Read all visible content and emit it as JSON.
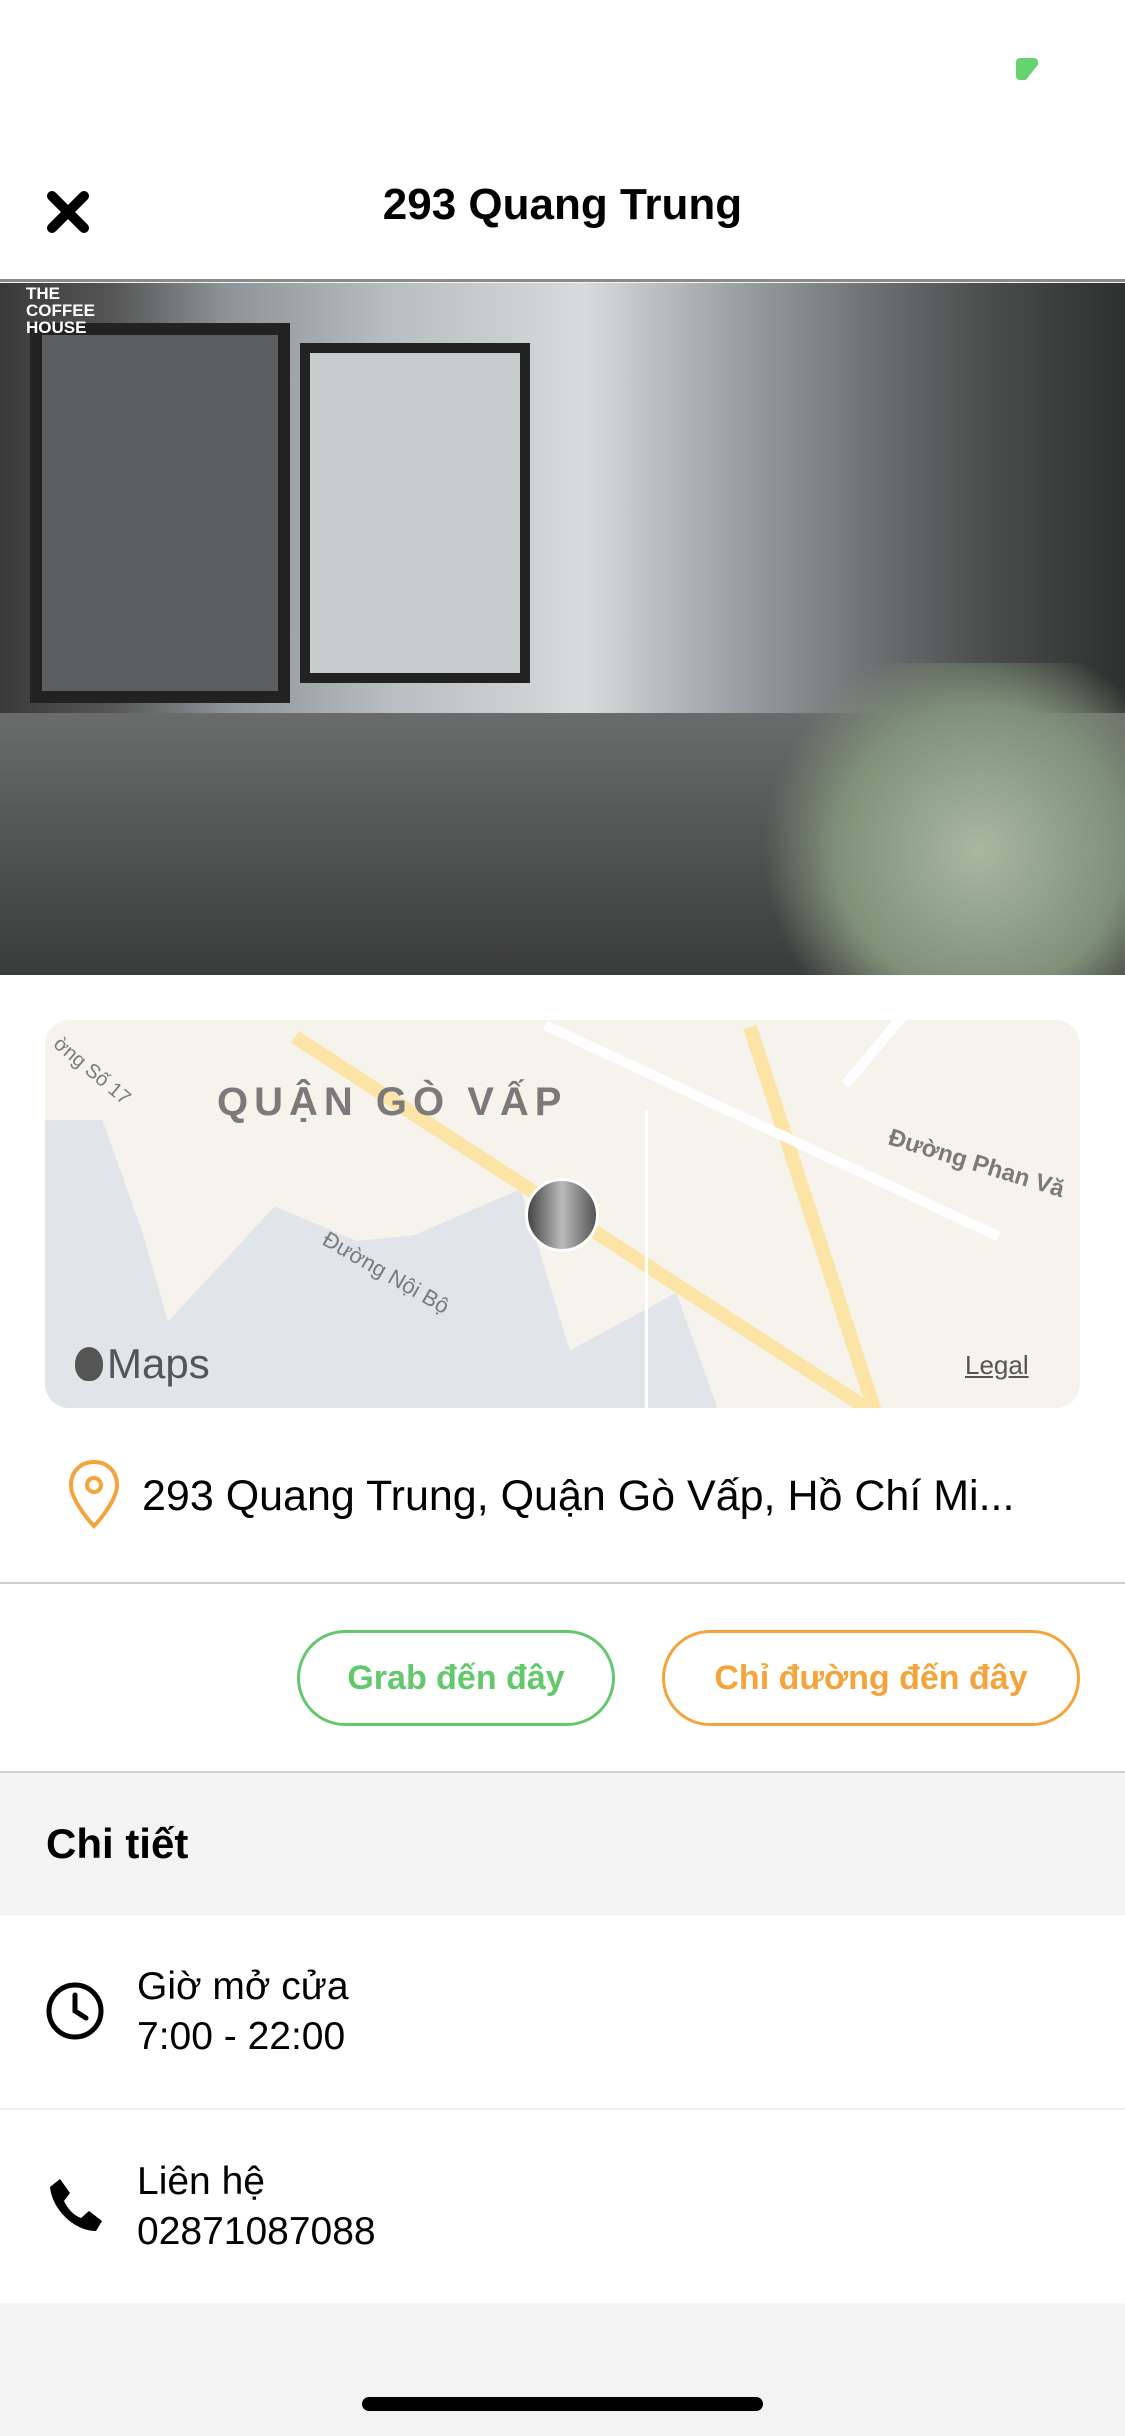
{
  "status_bar": {
    "battery_color": "#65d46e"
  },
  "nav": {
    "title": "293 Quang Trung",
    "close_icon": "close-icon"
  },
  "photo": {
    "logo_lines": [
      "THE",
      "COFFEE",
      "HOUSE"
    ]
  },
  "map": {
    "district_label": "QUẬN GÒ VẤP",
    "street_labels": [
      "ờng Số 17",
      "Đường Phan Vă",
      "Đường Nội Bộ"
    ],
    "brand": "Maps",
    "legal": "Legal"
  },
  "address": {
    "text": "293 Quang Trung, Quận Gò Vấp, Hồ Chí Mi...",
    "icon": "location-pin-icon"
  },
  "actions": {
    "grab": "Grab đến đây",
    "directions": "Chỉ đường đến đây"
  },
  "details": {
    "title": "Chi tiết",
    "rows": [
      {
        "icon": "clock-icon",
        "label": "Giờ mở cửa",
        "value": "7:00 - 22:00"
      },
      {
        "icon": "phone-icon",
        "label": "Liên hệ",
        "value": "02871087088"
      }
    ]
  },
  "colors": {
    "green": "#62c86b",
    "orange": "#f4a43a"
  }
}
